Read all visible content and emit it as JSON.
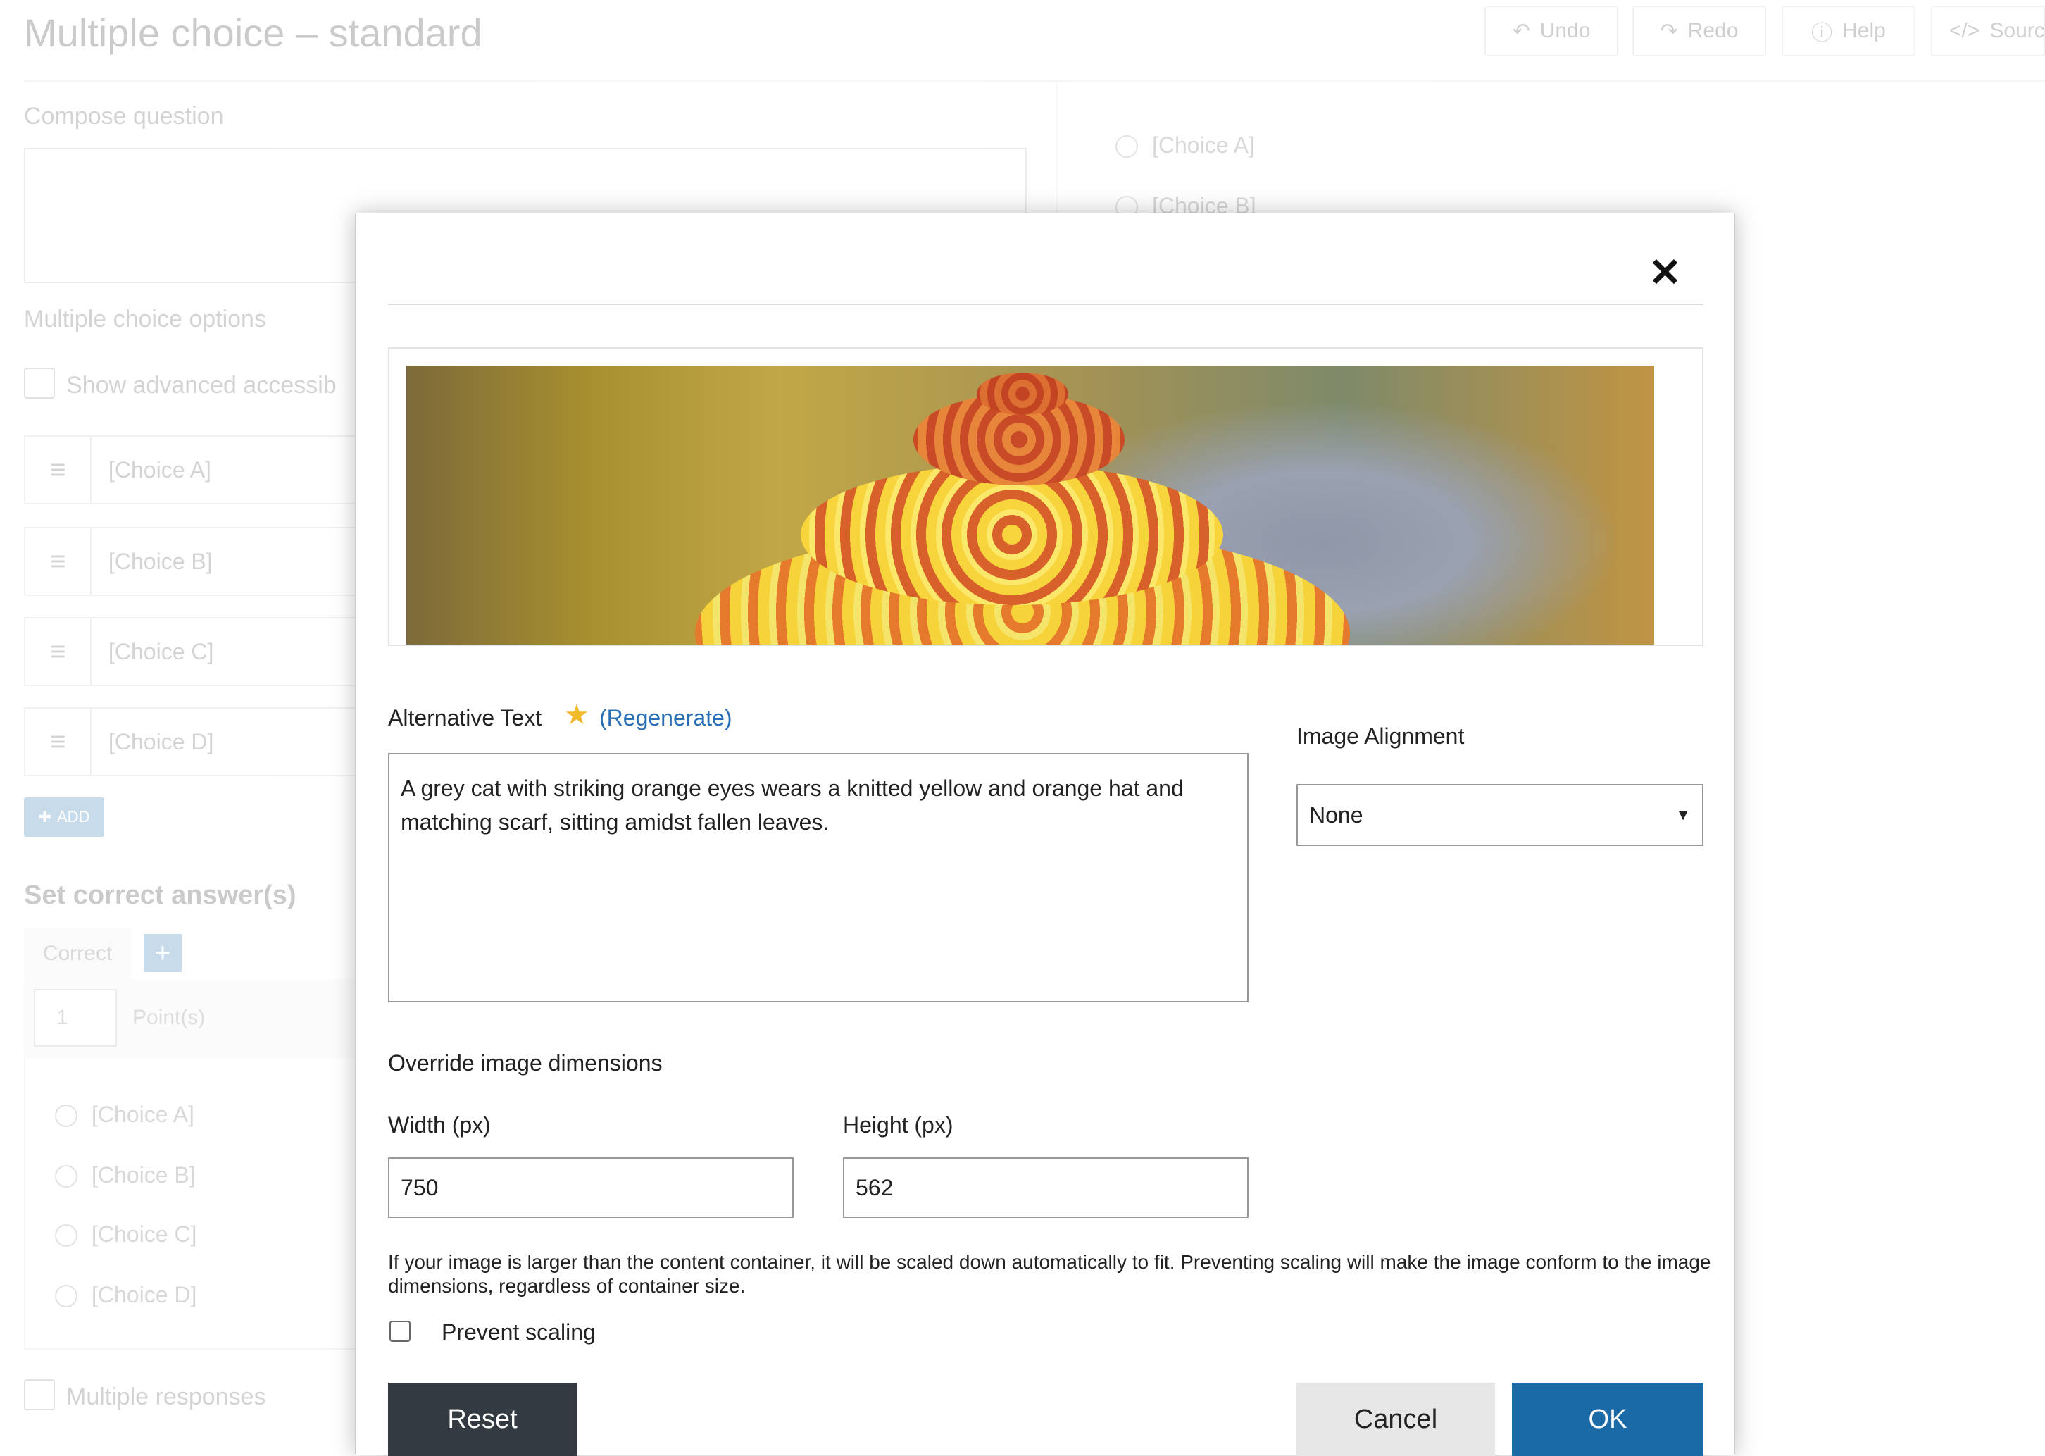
{
  "background": {
    "title": "Multiple choice – standard",
    "toolbar": {
      "undo": "Undo",
      "redo": "Redo",
      "help": "Help",
      "source": "Source"
    },
    "compose_label": "Compose question",
    "options_label": "Multiple choice options",
    "advanced_label": "Show advanced accessib",
    "choices": [
      "[Choice A]",
      "[Choice B]",
      "[Choice C]",
      "[Choice D]"
    ],
    "add_label": "ADD",
    "set_correct_label": "Set correct answer(s)",
    "correct_tab": "Correct",
    "points_value": "1",
    "points_label": "Point(s)",
    "answer_choices": [
      "[Choice A]",
      "[Choice B]",
      "[Choice C]",
      "[Choice D]"
    ],
    "preview_choices": [
      "[Choice A]",
      "[Choice B]"
    ],
    "multiple_responses_label": "Multiple responses"
  },
  "modal": {
    "close_symbol": "✕",
    "alt_text_label": "Alternative Text",
    "regenerate_label": "(Regenerate)",
    "alt_text_value": "A grey cat with striking orange eyes wears a knitted yellow and orange hat and matching scarf, sitting amidst fallen leaves.",
    "alignment_label": "Image Alignment",
    "alignment_value": "None",
    "override_label": "Override image dimensions",
    "width_label": "Width (px)",
    "width_value": "750",
    "height_label": "Height (px)",
    "height_value": "562",
    "help_text": "If your image is larger than the content container, it will be scaled down automatically to fit. Preventing scaling will make the image conform to the image dimensions, regardless of container size.",
    "prevent_scaling_label": "Prevent scaling",
    "prevent_scaling_checked": false,
    "reset_label": "Reset",
    "cancel_label": "Cancel",
    "ok_label": "OK"
  },
  "colors": {
    "primary": "#1a6aa8",
    "reset_bg": "#333a42",
    "cancel_bg": "#e6e6e6",
    "link": "#2a6fb5"
  }
}
